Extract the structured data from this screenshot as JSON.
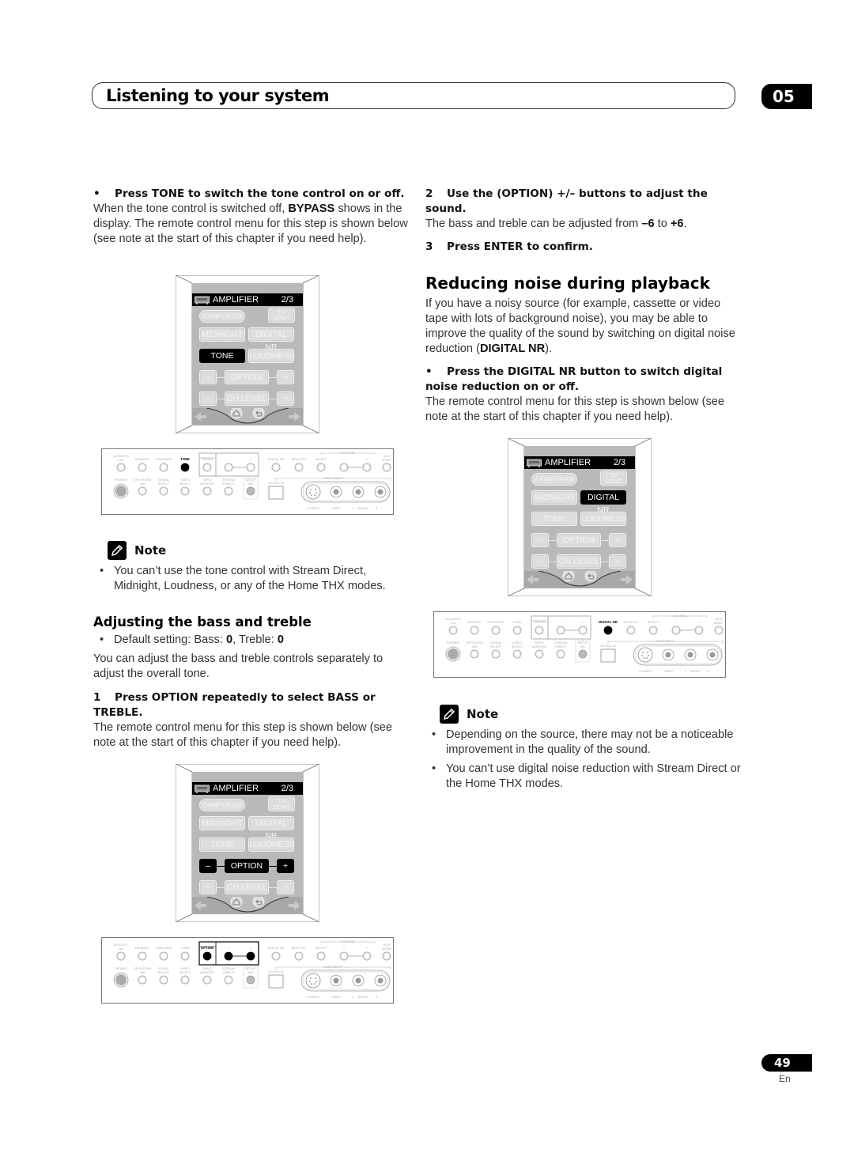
{
  "header": {
    "title": "Listening to your system",
    "chapter": "05"
  },
  "left": {
    "tone_step": {
      "heading": "Press TONE to switch the tone control on or off.",
      "body_pre": "When the tone control is switched off, ",
      "body_bold": "BYPASS",
      "body_post": " shows in the display. The remote control menu for this step is shown below (see note at the start of this chapter if you need help)."
    },
    "note1": {
      "label": "Note",
      "items": [
        "You can’t use the tone control with Stream Direct, Midnight, Loudness, or any of the Home THX modes."
      ]
    },
    "bass_section": {
      "heading": "Adjusting the bass and treble",
      "default_pre": "Default setting: Bass: ",
      "default_bass": "0",
      "default_mid": ", Treble: ",
      "default_treble": "0",
      "intro": "You can adjust the bass and treble controls separately to adjust the overall tone.",
      "step1_num": "1",
      "step1_heading": "Press OPTION repeatedly to select BASS or TREBLE.",
      "step1_body": "The remote control menu for this step is shown below (see note at the start of this chapter if you need help)."
    }
  },
  "right": {
    "step2_num": "2",
    "step2_heading": "Use the (OPTION) +/– buttons to adjust the sound.",
    "step2_body_pre": "The bass and treble can be adjusted from ",
    "step2_min": "–6",
    "step2_mid": " to ",
    "step2_max": "+6",
    "step2_end": ".",
    "step3_num": "3",
    "step3_heading": "Press ENTER to confirm.",
    "noise_section": {
      "heading": "Reducing noise during playback",
      "intro_pre": "If you have a noisy source (for example, cassette or video tape with lots of background noise), you may be able to improve the quality of the sound by switching on digital noise reduction (",
      "intro_bold": "DIGITAL NR",
      "intro_post": ").",
      "step_heading": "Press the DIGITAL NR button to switch digital noise reduction on or off.",
      "step_body": "The remote control menu for this step is shown below (see note at the start of this chapter if you need help)."
    },
    "note2": {
      "label": "Note",
      "items": [
        "Depending on the source, there may not be a noticeable improvement in the quality of the sound.",
        "You can’t use digital noise reduction with Stream Direct or the Home THX modes."
      ]
    }
  },
  "remote_screen": {
    "title": "AMPLIFIER",
    "page": "2/3",
    "power_label": "AMPLIFIER",
    "tv_cont_line1": "TV",
    "tv_cont_line2": "CONT",
    "midnight": "MIDNIGHT",
    "digital_nr": "DIGITAL NR",
    "tone": "TONE",
    "loudness": "LOUDNESS",
    "minus": "–",
    "option": "OPTION",
    "plus": "+",
    "ch_level": "CH LEVEL"
  },
  "remote_highlights": {
    "remote1": "TONE",
    "remote2": "DIGITAL NR",
    "remote3": "OPTION"
  },
  "front_panel": {
    "row1_labels": [
      "ACOUSTIC CAL",
      "MIDNIGHT",
      "LOUDNESS",
      "TONE",
      "OPTION",
      "–",
      "+",
      "DIGITAL NR",
      "INPUT ATT",
      "SELECT",
      "–",
      "+",
      "MCH MODE"
    ],
    "ch_level_label": "CH LEVEL",
    "row2_labels": [
      "PHONES",
      "SP SYSTEM A/B",
      "SIGNAL SELECT",
      "VIDEO SELECT",
      "TAPE2 MONITOR",
      "STREAM DIRECT",
      "SETUP MIC"
    ],
    "digital_in": "DIGITAL IN",
    "video_input": "VIDEO INPUT",
    "jack_labels": [
      "S-VIDEO",
      "VIDEO",
      "L",
      "AUDIO",
      "R"
    ]
  },
  "panel_highlights": {
    "panel1": "TONE",
    "panel2": "DIGITAL NR",
    "panel3": "OPTION"
  },
  "footer": {
    "page_number": "49",
    "language": "En"
  }
}
